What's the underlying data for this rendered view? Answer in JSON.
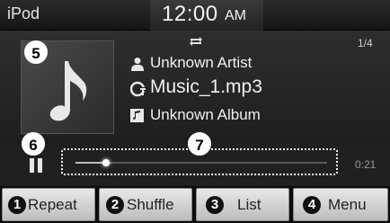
{
  "status_bar": {
    "source": "iPod",
    "time": "12:00",
    "am_pm": "AM"
  },
  "now_playing": {
    "track_count": "1/4",
    "artist": "Unknown Artist",
    "file_name": "Music_1.mp3",
    "album": "Unknown Album",
    "elapsed": "0:21",
    "progress_fraction": 0.12
  },
  "callouts": {
    "album_art": "5",
    "pause": "6",
    "progress": "7"
  },
  "buttons": [
    {
      "num": "1",
      "label": "Repeat"
    },
    {
      "num": "2",
      "label": "Shuffle"
    },
    {
      "num": "3",
      "label": "List"
    },
    {
      "num": "4",
      "label": "Menu"
    }
  ],
  "icons": {
    "album_art": "music-note-icon",
    "repeat": "repeat-icon",
    "artist": "person-icon",
    "file": "file-music-icon",
    "album": "album-icon",
    "pause": "pause-icon"
  }
}
